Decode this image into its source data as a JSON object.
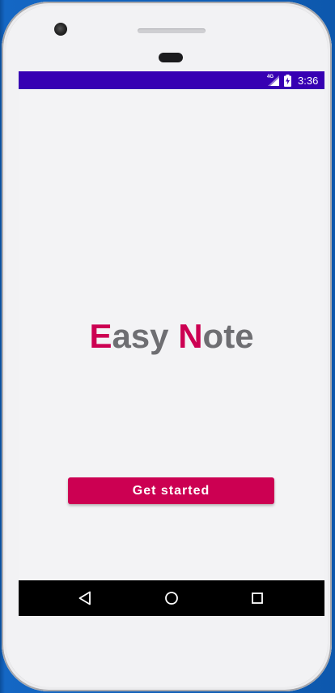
{
  "status_bar": {
    "network_label": "4G",
    "time": "3:36",
    "background": "#3700b3",
    "icons": [
      "signal-icon",
      "battery-icon"
    ]
  },
  "app": {
    "title_parts": [
      {
        "text": "E",
        "color": "#cc0052"
      },
      {
        "text": "asy ",
        "color": "#6e6e72"
      },
      {
        "text": "N",
        "color": "#cc0052"
      },
      {
        "text": "ote",
        "color": "#6e6e72"
      }
    ],
    "get_started_label": "Get started",
    "accent_color": "#cc0052"
  },
  "nav_bar": {
    "buttons": [
      "back-icon",
      "home-icon",
      "recents-icon"
    ]
  }
}
